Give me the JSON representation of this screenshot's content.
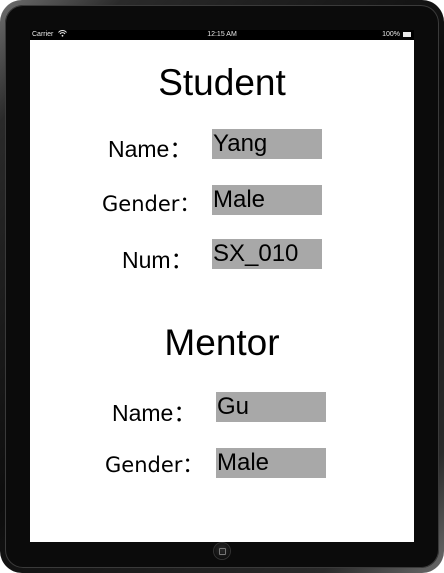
{
  "status_bar": {
    "carrier": "Carrier",
    "time": "12:15 AM",
    "battery": "100%"
  },
  "student": {
    "title": "Student",
    "name_label": "Name：",
    "name_value": "Yang",
    "gender_label": "Gender：",
    "gender_value": "Male",
    "num_label": "Num：",
    "num_value": "SX_010"
  },
  "mentor": {
    "title": "Mentor",
    "name_label": "Name：",
    "name_value": "Gu",
    "gender_label": "Gender：",
    "gender_value": "Male"
  },
  "colors": {
    "value_field_bg": "#a8a8a8",
    "screen_bg": "#ffffff",
    "device_frame": "#0b0b0b"
  },
  "icons": [
    "wifi-icon",
    "battery-icon",
    "home-button-icon"
  ]
}
